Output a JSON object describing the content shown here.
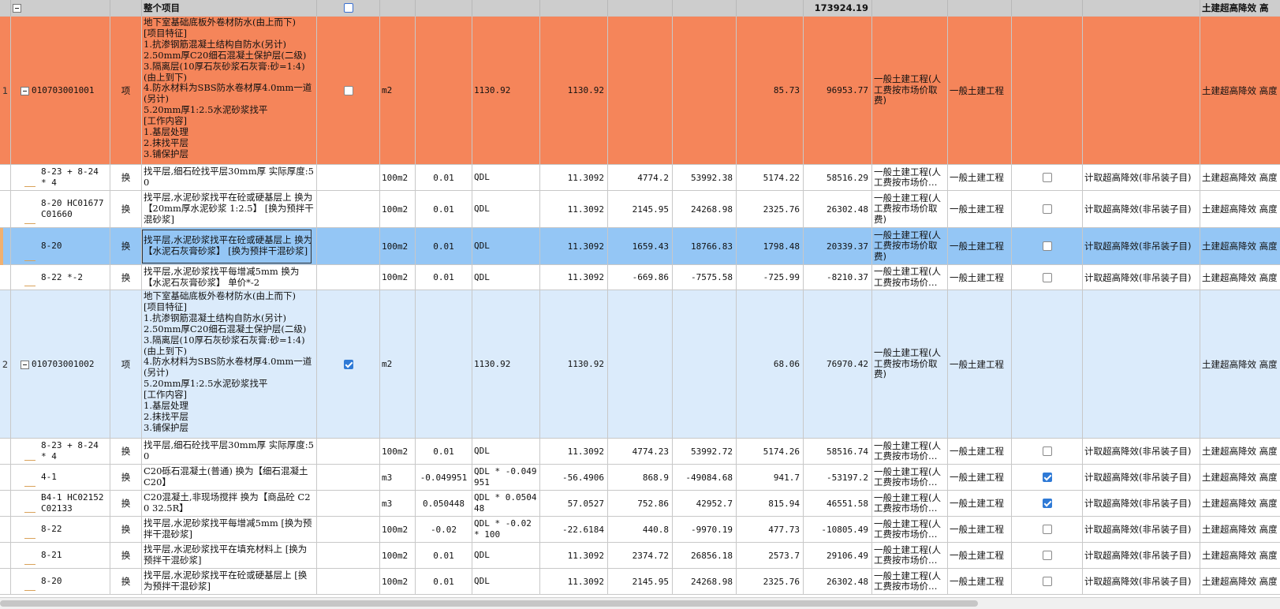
{
  "header": {
    "title": "整个项目",
    "total": "173924.19",
    "note": "土建超高降效 高"
  },
  "rows": [
    {
      "num": "1",
      "code": "010703001001",
      "type": "项",
      "desc": "地下室基础底板外卷材防水(由上而下)\n[项目特征]\n1.抗渗钢筋混凝土结构自防水(另计)\n2.50mm厚C20细石混凝土保护层(二级)\n3.隔离层(10厚石灰砂浆石灰膏:砂=1:4)\n(由上到下)\n4.防水材料为SBS防水卷材厚4.0mm一道\n(另计)\n5.20mm厚1:2.5水泥砂浆找平\n[工作内容]\n1.基层处理\n2.抹找平层\n3.铺保护层",
      "unit": "m2",
      "content": "",
      "expr": "1130.92",
      "qty": "1130.92",
      "price": "",
      "total_a": "",
      "price_b": "85.73",
      "total_b": "96953.77",
      "category": "一般土建工程(人工费按市场价取费)",
      "major": "一般土建工程",
      "rule": "",
      "note": "土建超高降效 高度"
    },
    {
      "num": "",
      "code": "8-23 + 8-24 * 4",
      "type": "换",
      "desc": "找平层,细石砼找平层30mm厚 实际厚度:50",
      "unit": "100m2",
      "content": "0.01",
      "expr": "QDL",
      "qty": "11.3092",
      "price": "4774.2",
      "total_a": "53992.38",
      "price_b": "5174.22",
      "total_b": "58516.29",
      "category": "一般土建工程(人工费按市场价…",
      "major": "一般土建工程",
      "rule": "计取超高降效(非吊装子目)",
      "note": "土建超高降效 高度"
    },
    {
      "num": "",
      "code": "8-20 HC01677 C01660",
      "type": "换",
      "desc": "找平层,水泥砂浆找平在砼或硬基层上 换为【20mm厚水泥砂浆 1:2.5】 [换为预拌干混砂浆]",
      "unit": "100m2",
      "content": "0.01",
      "expr": "QDL",
      "qty": "11.3092",
      "price": "2145.95",
      "total_a": "24268.98",
      "price_b": "2325.76",
      "total_b": "26302.48",
      "category": "一般土建工程(人工费按市场价取费)",
      "major": "一般土建工程",
      "rule": "计取超高降效(非吊装子目)",
      "note": "土建超高降效 高度"
    },
    {
      "num": "",
      "code": "8-20",
      "type": "换",
      "desc": "找平层,水泥砂浆找平在砼或硬基层上 换为【水泥石灰膏砂浆】 [换为预拌干混砂浆]",
      "unit": "100m2",
      "content": "0.01",
      "expr": "QDL",
      "qty": "11.3092",
      "price": "1659.43",
      "total_a": "18766.83",
      "price_b": "1798.48",
      "total_b": "20339.37",
      "category": "一般土建工程(人工费按市场价取费)",
      "major": "一般土建工程",
      "rule": "计取超高降效(非吊装子目)",
      "note": "土建超高降效 高度"
    },
    {
      "num": "",
      "code": "8-22 *-2",
      "type": "换",
      "desc": "找平层,水泥砂浆找平每增减5mm 换为【水泥石灰膏砂浆】 单价*-2",
      "unit": "100m2",
      "content": "0.01",
      "expr": "QDL",
      "qty": "11.3092",
      "price": "-669.86",
      "total_a": "-7575.58",
      "price_b": "-725.99",
      "total_b": "-8210.37",
      "category": "一般土建工程(人工费按市场价…",
      "major": "一般土建工程",
      "rule": "计取超高降效(非吊装子目)",
      "note": "土建超高降效 高度"
    },
    {
      "num": "2",
      "code": "010703001002",
      "type": "项",
      "desc": "地下室基础底板外卷材防水(由上而下)\n[项目特征]\n1.抗渗钢筋混凝土结构自防水(另计)\n2.50mm厚C20细石混凝土保护层(二级)\n3.隔离层(10厚石灰砂浆石灰膏:砂=1:4)\n(由上到下)\n4.防水材料为SBS防水卷材厚4.0mm一道\n(另计)\n5.20mm厚1:2.5水泥砂浆找平\n[工作内容]\n1.基层处理\n2.抹找平层\n3.铺保护层",
      "unit": "m2",
      "content": "",
      "expr": "1130.92",
      "qty": "1130.92",
      "price": "",
      "total_a": "",
      "price_b": "68.06",
      "total_b": "76970.42",
      "category": "一般土建工程(人工费按市场价取费)",
      "major": "一般土建工程",
      "rule": "",
      "note": "土建超高降效 高度"
    },
    {
      "num": "",
      "code": "8-23 + 8-24 * 4",
      "type": "换",
      "desc": "找平层,细石砼找平层30mm厚 实际厚度:50",
      "unit": "100m2",
      "content": "0.01",
      "expr": "QDL",
      "qty": "11.3092",
      "price": "4774.23",
      "total_a": "53992.72",
      "price_b": "5174.26",
      "total_b": "58516.74",
      "category": "一般土建工程(人工费按市场价…",
      "major": "一般土建工程",
      "rule": "计取超高降效(非吊装子目)",
      "note": "土建超高降效 高度"
    },
    {
      "num": "",
      "code": "4-1",
      "type": "换",
      "desc": "C20砾石混凝土(普通) 换为【细石混凝土 C20】",
      "unit": "m3",
      "content": "-0.049951",
      "expr": "QDL * -0.049951",
      "qty": "-56.4906",
      "price": "868.9",
      "total_a": "-49084.68",
      "price_b": "941.7",
      "total_b": "-53197.2",
      "category": "一般土建工程(人工费按市场价…",
      "major": "一般土建工程",
      "rule": "计取超高降效(非吊装子目)",
      "note": "土建超高降效 高度"
    },
    {
      "num": "",
      "code": "B4-1 HC02152 C02133",
      "type": "换",
      "desc": "C20混凝土,非现场搅拌 换为【商品砼 C20 32.5R】",
      "unit": "m3",
      "content": "0.050448",
      "expr": "QDL * 0.050448",
      "qty": "57.0527",
      "price": "752.86",
      "total_a": "42952.7",
      "price_b": "815.94",
      "total_b": "46551.58",
      "category": "一般土建工程(人工费按市场价…",
      "major": "一般土建工程",
      "rule": "计取超高降效(非吊装子目)",
      "note": "土建超高降效 高度"
    },
    {
      "num": "",
      "code": "8-22",
      "type": "换",
      "desc": "找平层,水泥砂浆找平每增减5mm [换为预拌干混砂浆]",
      "unit": "100m2",
      "content": "-0.02",
      "expr": "QDL * -0.02 * 100",
      "qty": "-22.6184",
      "price": "440.8",
      "total_a": "-9970.19",
      "price_b": "477.73",
      "total_b": "-10805.49",
      "category": "一般土建工程(人工费按市场价…",
      "major": "一般土建工程",
      "rule": "计取超高降效(非吊装子目)",
      "note": "土建超高降效 高度"
    },
    {
      "num": "",
      "code": "8-21",
      "type": "换",
      "desc": "找平层,水泥砂浆找平在填充材料上 [换为预拌干混砂浆]",
      "unit": "100m2",
      "content": "0.01",
      "expr": "QDL",
      "qty": "11.3092",
      "price": "2374.72",
      "total_a": "26856.18",
      "price_b": "2573.7",
      "total_b": "29106.49",
      "category": "一般土建工程(人工费按市场价…",
      "major": "一般土建工程",
      "rule": "计取超高降效(非吊装子目)",
      "note": "土建超高降效 高度"
    },
    {
      "num": "",
      "code": "8-20",
      "type": "换",
      "desc": "找平层,水泥砂浆找平在砼或硬基层上 [换为预拌干混砂浆]",
      "unit": "100m2",
      "content": "0.01",
      "expr": "QDL",
      "qty": "11.3092",
      "price": "2145.95",
      "total_a": "24268.98",
      "price_b": "2325.76",
      "total_b": "26302.48",
      "category": "一般土建工程(人工费按市场价…",
      "major": "一般土建工程",
      "rule": "计取超高降效(非吊装子目)",
      "note": "土建超高降效 高度"
    }
  ]
}
